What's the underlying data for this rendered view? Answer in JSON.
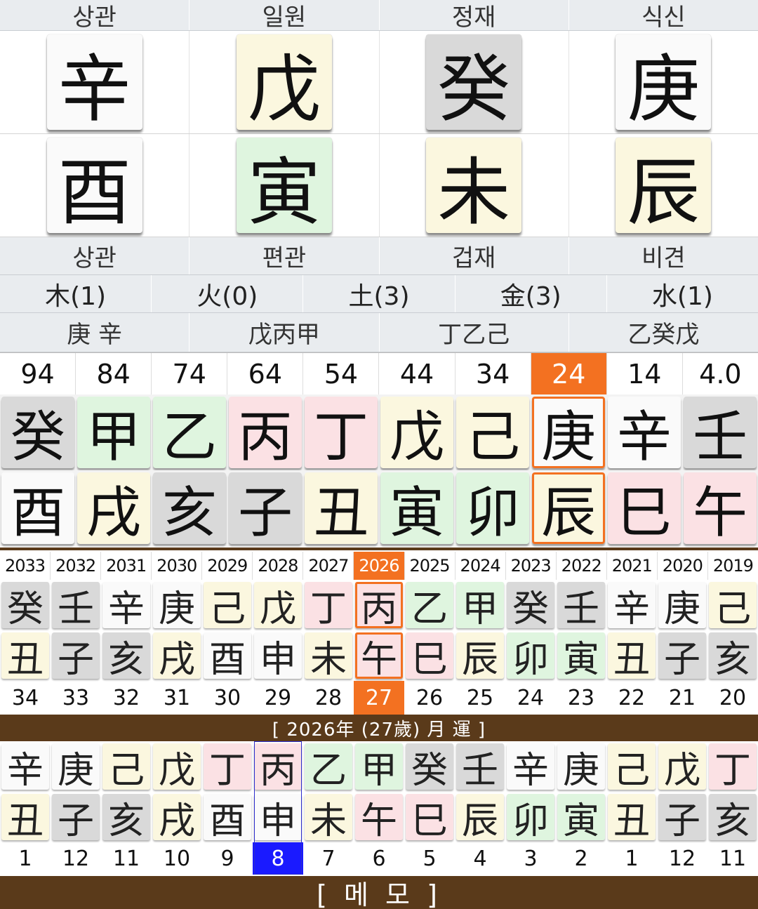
{
  "pillars": {
    "top_labels": [
      "상관",
      "일원",
      "정재",
      "식신"
    ],
    "stems": [
      {
        "char": "辛",
        "color": "white"
      },
      {
        "char": "戊",
        "color": "yellow"
      },
      {
        "char": "癸",
        "color": "gray"
      },
      {
        "char": "庚",
        "color": "white"
      }
    ],
    "branches": [
      {
        "char": "酉",
        "color": "white"
      },
      {
        "char": "寅",
        "color": "green"
      },
      {
        "char": "未",
        "color": "yellow"
      },
      {
        "char": "辰",
        "color": "yellow"
      }
    ],
    "bottom_labels": [
      "상관",
      "편관",
      "겁재",
      "비견"
    ]
  },
  "elements": [
    "木(1)",
    "火(0)",
    "土(3)",
    "金(3)",
    "水(1)"
  ],
  "hidden_stems": [
    "庚 辛",
    "戊丙甲",
    "丁乙己",
    "乙癸戊"
  ],
  "daeun": {
    "ages": [
      "94",
      "84",
      "74",
      "64",
      "54",
      "44",
      "34",
      "24",
      "14",
      "4.0"
    ],
    "selected_index": 7,
    "stems": [
      {
        "char": "癸",
        "color": "gray"
      },
      {
        "char": "甲",
        "color": "green"
      },
      {
        "char": "乙",
        "color": "green"
      },
      {
        "char": "丙",
        "color": "red"
      },
      {
        "char": "丁",
        "color": "red"
      },
      {
        "char": "戊",
        "color": "yellow"
      },
      {
        "char": "己",
        "color": "yellow"
      },
      {
        "char": "庚",
        "color": "white"
      },
      {
        "char": "辛",
        "color": "white"
      },
      {
        "char": "壬",
        "color": "gray"
      }
    ],
    "branches": [
      {
        "char": "酉",
        "color": "white"
      },
      {
        "char": "戌",
        "color": "yellow"
      },
      {
        "char": "亥",
        "color": "gray"
      },
      {
        "char": "子",
        "color": "gray"
      },
      {
        "char": "丑",
        "color": "yellow"
      },
      {
        "char": "寅",
        "color": "green"
      },
      {
        "char": "卯",
        "color": "green"
      },
      {
        "char": "辰",
        "color": "yellow"
      },
      {
        "char": "巳",
        "color": "red"
      },
      {
        "char": "午",
        "color": "red"
      }
    ]
  },
  "seun": {
    "years": [
      "2033",
      "2032",
      "2031",
      "2030",
      "2029",
      "2028",
      "2027",
      "2026",
      "2025",
      "2024",
      "2023",
      "2022",
      "2021",
      "2020",
      "2019"
    ],
    "selected_index": 7,
    "stems": [
      {
        "char": "癸",
        "color": "gray"
      },
      {
        "char": "壬",
        "color": "gray"
      },
      {
        "char": "辛",
        "color": "white"
      },
      {
        "char": "庚",
        "color": "white"
      },
      {
        "char": "己",
        "color": "yellow"
      },
      {
        "char": "戊",
        "color": "yellow"
      },
      {
        "char": "丁",
        "color": "red"
      },
      {
        "char": "丙",
        "color": "red"
      },
      {
        "char": "乙",
        "color": "green"
      },
      {
        "char": "甲",
        "color": "green"
      },
      {
        "char": "癸",
        "color": "gray"
      },
      {
        "char": "壬",
        "color": "gray"
      },
      {
        "char": "辛",
        "color": "white"
      },
      {
        "char": "庚",
        "color": "white"
      },
      {
        "char": "己",
        "color": "yellow"
      }
    ],
    "branches": [
      {
        "char": "丑",
        "color": "yellow"
      },
      {
        "char": "子",
        "color": "gray"
      },
      {
        "char": "亥",
        "color": "gray"
      },
      {
        "char": "戌",
        "color": "yellow"
      },
      {
        "char": "酉",
        "color": "white"
      },
      {
        "char": "申",
        "color": "white"
      },
      {
        "char": "未",
        "color": "yellow"
      },
      {
        "char": "午",
        "color": "red"
      },
      {
        "char": "巳",
        "color": "red"
      },
      {
        "char": "辰",
        "color": "yellow"
      },
      {
        "char": "卯",
        "color": "green"
      },
      {
        "char": "寅",
        "color": "green"
      },
      {
        "char": "丑",
        "color": "yellow"
      },
      {
        "char": "子",
        "color": "gray"
      },
      {
        "char": "亥",
        "color": "gray"
      }
    ],
    "ages": [
      "34",
      "33",
      "32",
      "31",
      "30",
      "29",
      "28",
      "27",
      "26",
      "25",
      "24",
      "23",
      "22",
      "21",
      "20"
    ]
  },
  "wolun": {
    "title": "[ 2026年 (27歲) 月 運 ]",
    "selected_index": 5,
    "stems": [
      {
        "char": "辛",
        "color": "white"
      },
      {
        "char": "庚",
        "color": "white"
      },
      {
        "char": "己",
        "color": "yellow"
      },
      {
        "char": "戊",
        "color": "yellow"
      },
      {
        "char": "丁",
        "color": "red"
      },
      {
        "char": "丙",
        "color": "red"
      },
      {
        "char": "乙",
        "color": "green"
      },
      {
        "char": "甲",
        "color": "green"
      },
      {
        "char": "癸",
        "color": "gray"
      },
      {
        "char": "壬",
        "color": "gray"
      },
      {
        "char": "辛",
        "color": "white"
      },
      {
        "char": "庚",
        "color": "white"
      },
      {
        "char": "己",
        "color": "yellow"
      },
      {
        "char": "戊",
        "color": "yellow"
      },
      {
        "char": "丁",
        "color": "red"
      }
    ],
    "branches": [
      {
        "char": "丑",
        "color": "yellow"
      },
      {
        "char": "子",
        "color": "gray"
      },
      {
        "char": "亥",
        "color": "gray"
      },
      {
        "char": "戌",
        "color": "yellow"
      },
      {
        "char": "酉",
        "color": "white"
      },
      {
        "char": "申",
        "color": "white"
      },
      {
        "char": "未",
        "color": "yellow"
      },
      {
        "char": "午",
        "color": "red"
      },
      {
        "char": "巳",
        "color": "red"
      },
      {
        "char": "辰",
        "color": "yellow"
      },
      {
        "char": "卯",
        "color": "green"
      },
      {
        "char": "寅",
        "color": "green"
      },
      {
        "char": "丑",
        "color": "yellow"
      },
      {
        "char": "子",
        "color": "gray"
      },
      {
        "char": "亥",
        "color": "gray"
      }
    ],
    "months": [
      "1",
      "12",
      "11",
      "10",
      "9",
      "8",
      "7",
      "6",
      "5",
      "4",
      "3",
      "2",
      "1",
      "12",
      "11"
    ]
  },
  "memo": {
    "label": "[ 메  모 ]"
  },
  "colors": {
    "accent": "#f37121",
    "brown": "#5a3a1a",
    "month_select": "#1a1aff"
  }
}
